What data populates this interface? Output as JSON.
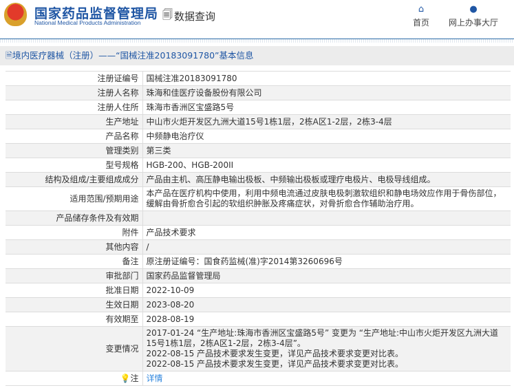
{
  "header": {
    "title_cn": "国家药品监督管理局",
    "title_en": "National Medical Products Administration",
    "query_label": "数据查询",
    "nav": [
      {
        "label": "首页",
        "icon": "home-icon"
      },
      {
        "label": "网上办事大厅",
        "icon": "user-icon"
      }
    ]
  },
  "breadcrumb": "境内医疗器械（注册）——“国械注准20183091780”基本信息",
  "rows": [
    {
      "label": "注册证编号",
      "value": "国械注准20183091780"
    },
    {
      "label": "注册人名称",
      "value": "珠海和佳医疗设备股份有限公司"
    },
    {
      "label": "注册人住所",
      "value": "珠海市香洲区宝盛路5号"
    },
    {
      "label": "生产地址",
      "value": "中山市火炬开发区九洲大道15号1栋1层，2栋A区1-2层，2栋3-4层"
    },
    {
      "label": "产品名称",
      "value": "中频静电治疗仪"
    },
    {
      "label": "管理类别",
      "value": "第三类"
    },
    {
      "label": "型号规格",
      "value": "HGB-200、HGB-200II"
    },
    {
      "label": "结构及组成/主要组成成分",
      "value": "产品由主机、高压静电输出极板、中频输出极板或理疗电极片、电极导线组成。"
    },
    {
      "label": "适用范围/预期用途",
      "value": "本产品在医疗机构中使用，利用中频电流通过皮肤电极刺激软组织和静电场效应作用于骨伤部位，缓解由骨折愈合引起的软组织肿胀及疼痛症状，对骨折愈合作辅助治疗用。"
    },
    {
      "label": "产品储存条件及有效期",
      "value": ""
    },
    {
      "label": "附件",
      "value": "产品技术要求"
    },
    {
      "label": "其他内容",
      "value": "/"
    },
    {
      "label": "备注",
      "value": "原注册证编号：国食药监械(准)字2014第3260696号"
    },
    {
      "label": "审批部门",
      "value": "国家药品监督管理局"
    },
    {
      "label": "批准日期",
      "value": "2022-10-09"
    },
    {
      "label": "生效日期",
      "value": "2023-08-20"
    },
    {
      "label": "有效期至",
      "value": "2028-08-19"
    }
  ],
  "changes": {
    "label": "变更情况",
    "lines": [
      "2017-01-24 “生产地址:珠海市香洲区宝盛路5号” 变更为 “生产地址:中山市火炬开发区九洲大道15号1栋1层，2栋A区1-2层，2栋3-4层”。",
      "2022-08-15 产品技术要求发生变更，详见产品技术要求变更对比表。",
      "2022-08-15 产品技术要求发生变更，详见产品技术要求变更对比表。"
    ]
  },
  "note": {
    "label": "注",
    "link": "详情"
  }
}
